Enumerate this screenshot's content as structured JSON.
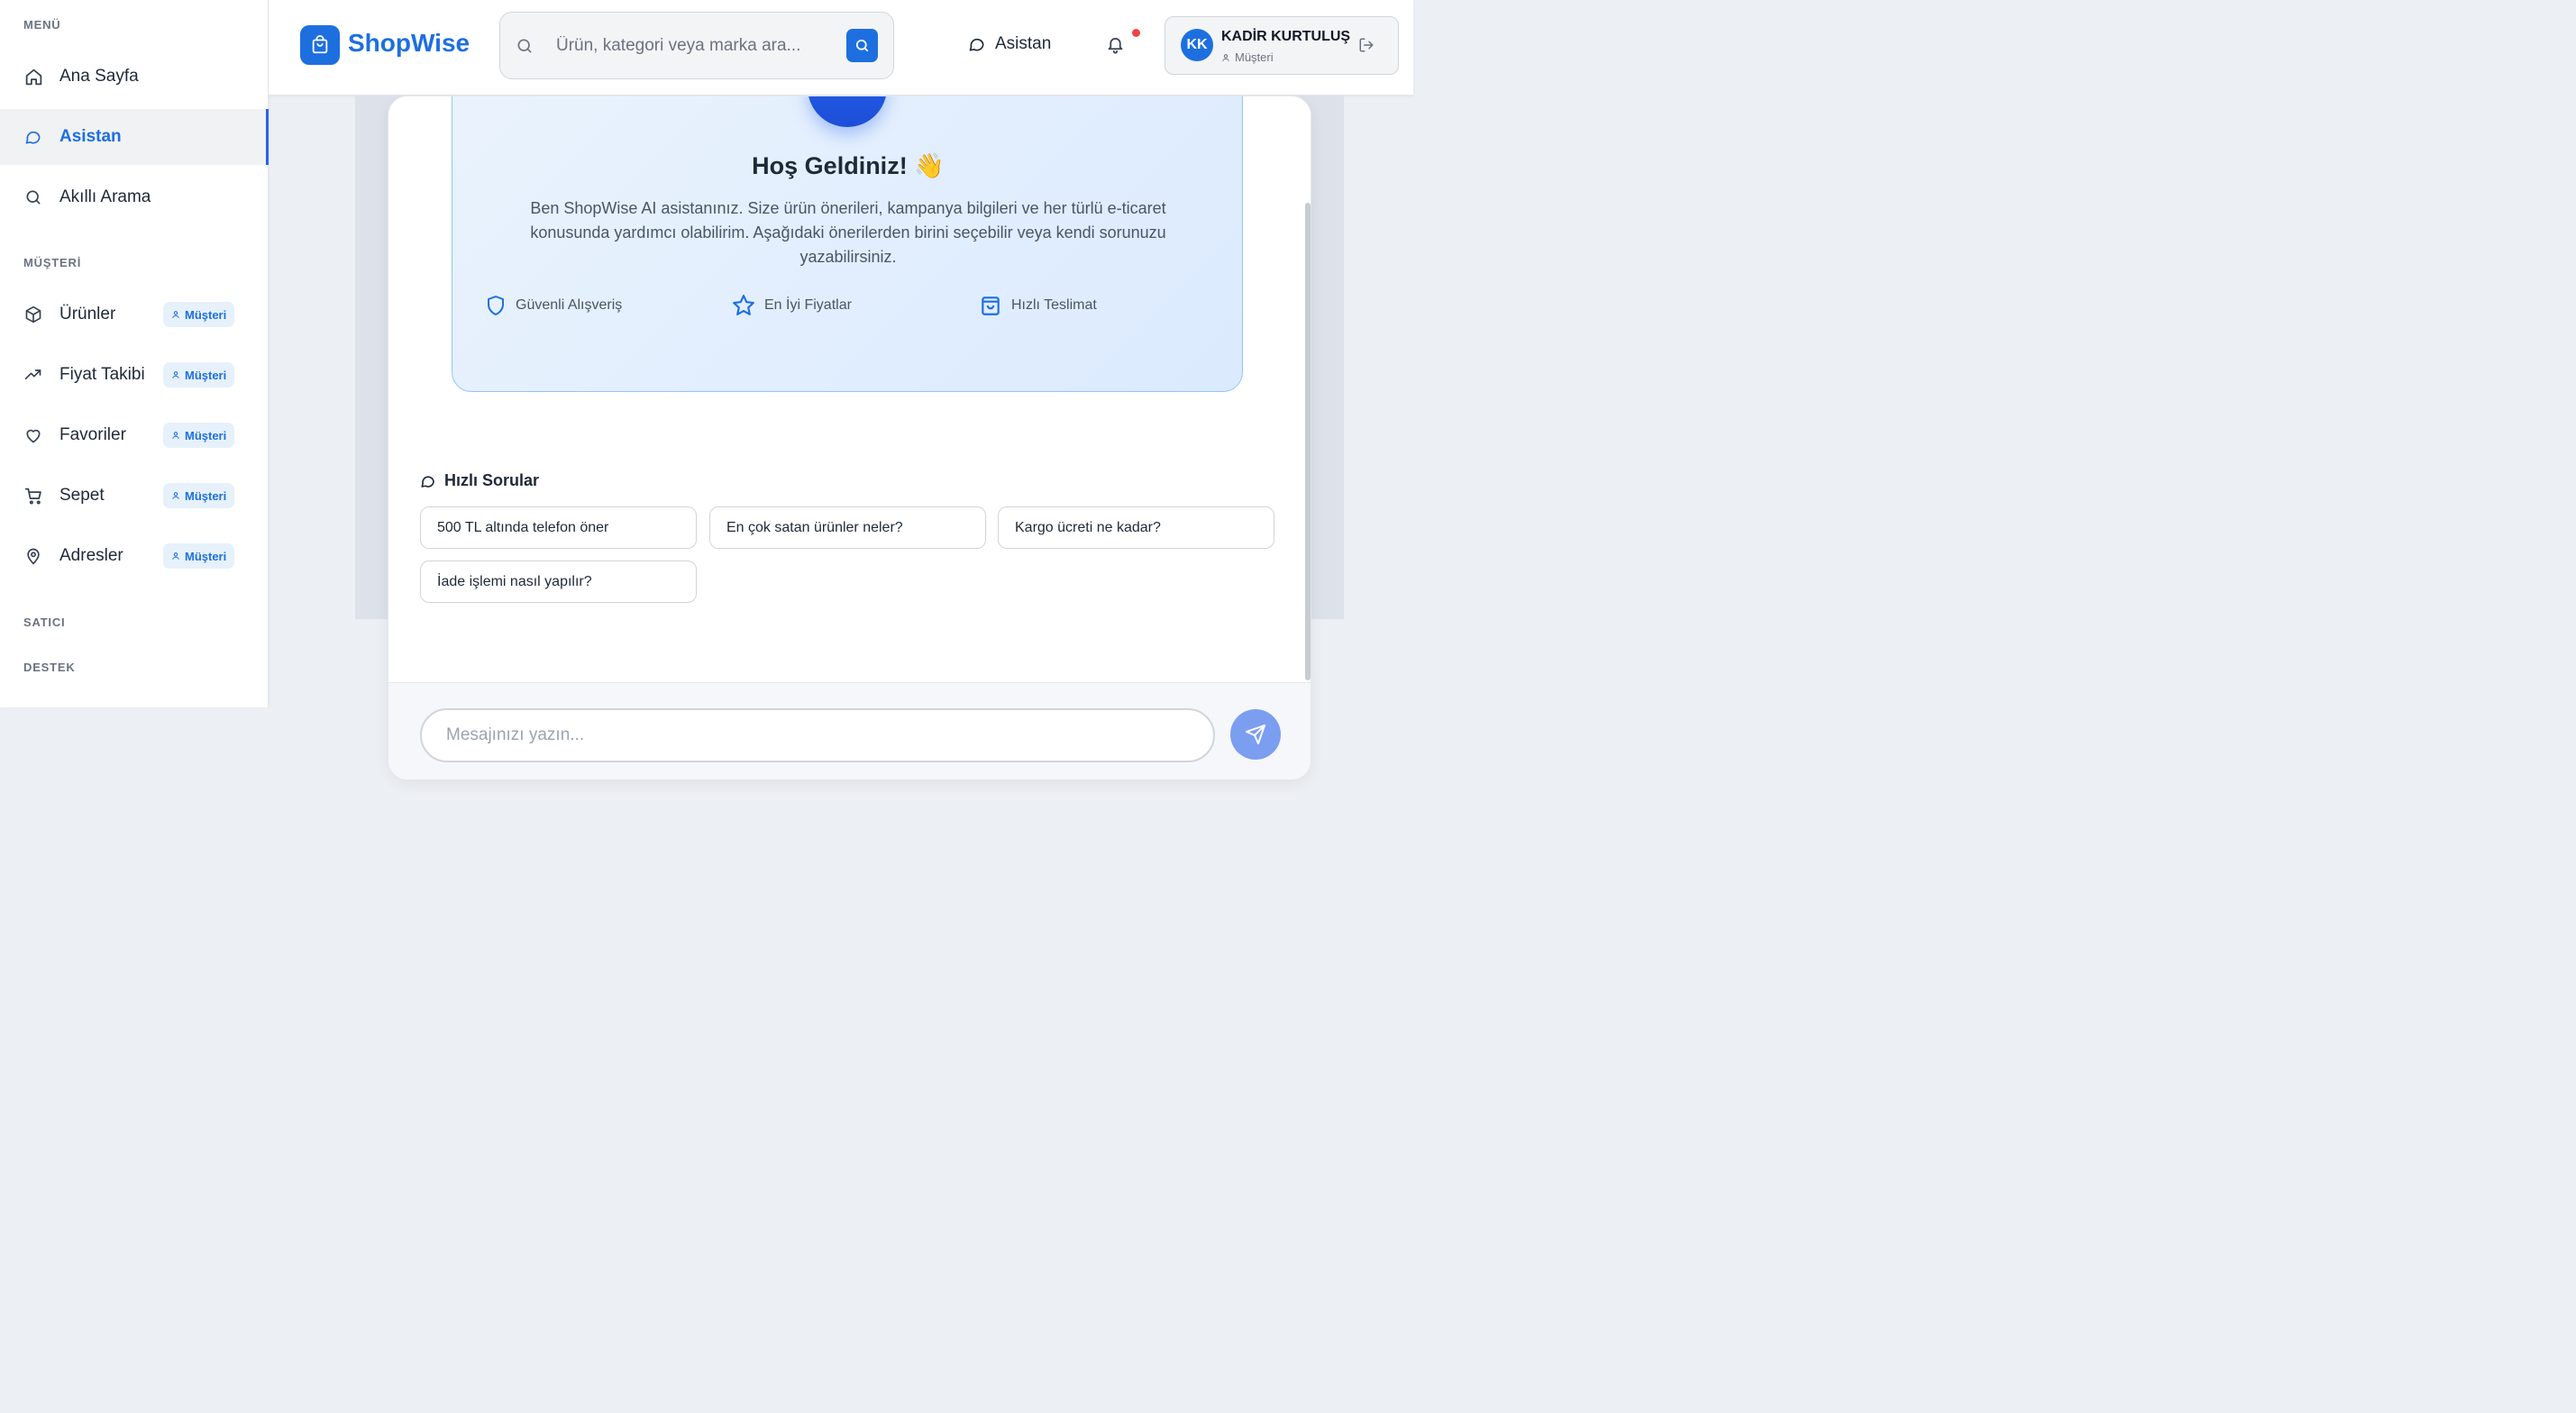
{
  "sidebar": {
    "menu_label": "MENÜ",
    "menu_items": [
      {
        "label": "Ana Sayfa",
        "icon": "home-icon"
      },
      {
        "label": "Asistan",
        "icon": "chat-icon",
        "active": true
      },
      {
        "label": "Akıllı Arama",
        "icon": "search-icon"
      }
    ],
    "customer_label": "MÜŞTERİ",
    "customer_items": [
      {
        "label": "Ürünler",
        "icon": "box-icon",
        "badge": "Müşteri"
      },
      {
        "label": "Fiyat Takibi",
        "icon": "trending-up-icon",
        "badge": "Müşteri"
      },
      {
        "label": "Favoriler",
        "icon": "heart-icon",
        "badge": "Müşteri"
      },
      {
        "label": "Sepet",
        "icon": "cart-icon",
        "badge": "Müşteri"
      },
      {
        "label": "Adresler",
        "icon": "map-pin-icon",
        "badge": "Müşteri"
      }
    ],
    "seller_label": "SATICI",
    "support_label": "DESTEK"
  },
  "header": {
    "brand": "ShopWise",
    "search_placeholder": "Ürün, kategori veya marka ara...",
    "assistant_link": "Asistan",
    "user": {
      "initials": "KK",
      "name": "KADİR KURTULUŞ",
      "role": "Müşteri"
    }
  },
  "welcome": {
    "title": "Hoş Geldiniz! 👋",
    "description": "Ben ShopWise AI asistanınız. Size ürün önerileri, kampanya bilgileri ve her türlü e-ticaret konusunda yardımcı olabilirim. Aşağıdaki önerilerden birini seçebilir veya kendi sorunuzu yazabilirsiniz.",
    "features": [
      {
        "label": "Güvenli Alışveriş",
        "icon": "shield-icon"
      },
      {
        "label": "En İyi Fiyatlar",
        "icon": "star-icon"
      },
      {
        "label": "Hızlı Teslimat",
        "icon": "shopping-bag-icon"
      }
    ]
  },
  "quick": {
    "title": "Hızlı Sorular",
    "questions": [
      "500 TL altında telefon öner",
      "En çok satan ürünler neler?",
      "Kargo ücreti ne kadar?",
      "İade işlemi nasıl yapılır?"
    ]
  },
  "composer": {
    "placeholder": "Mesajınızı yazın..."
  },
  "colors": {
    "accent": "#1d6fe0",
    "badge_bg": "#e6f1fb",
    "notification_dot": "#ef4444"
  }
}
